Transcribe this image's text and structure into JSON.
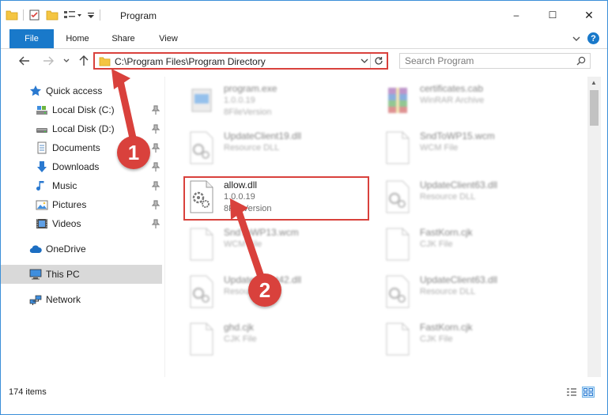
{
  "window": {
    "title": "Program",
    "controls": {
      "minimize": "–",
      "maximize": "☐",
      "close": "✕"
    }
  },
  "ribbon": {
    "tabs": [
      {
        "label": "File"
      },
      {
        "label": "Home"
      },
      {
        "label": "Share"
      },
      {
        "label": "View"
      }
    ],
    "help": "?"
  },
  "address_bar": {
    "path": "C:\\Program Files\\Program Directory",
    "search_placeholder": "Search Program"
  },
  "sidebar": {
    "items": [
      {
        "label": "Quick access",
        "icon": "star-icon"
      },
      {
        "label": "Local Disk (C:)",
        "icon": "drive-icon",
        "pinned": true
      },
      {
        "label": "Local Disk (D:)",
        "icon": "drive-icon",
        "pinned": true
      },
      {
        "label": "Documents",
        "icon": "documents-icon",
        "pinned": true
      },
      {
        "label": "Downloads",
        "icon": "downloads-icon",
        "pinned": true
      },
      {
        "label": "Music",
        "icon": "music-icon",
        "pinned": true
      },
      {
        "label": "Pictures",
        "icon": "pictures-icon",
        "pinned": true
      },
      {
        "label": "Videos",
        "icon": "videos-icon",
        "pinned": true
      },
      {
        "label": "OneDrive",
        "icon": "cloud-icon"
      },
      {
        "label": "This PC",
        "icon": "computer-icon",
        "selected": true
      },
      {
        "label": "Network",
        "icon": "network-icon"
      }
    ]
  },
  "files": [
    {
      "name": "program.exe",
      "line1": "1.0.0.19",
      "line2": "8FileVersion",
      "icon": "exe-icon"
    },
    {
      "name": "certificates.cab",
      "line1": "WinRAR Archive",
      "line2": "",
      "icon": "archive-icon"
    },
    {
      "name": "UpdateClient19.dll",
      "line1": "Resource DLL",
      "line2": "",
      "icon": "dll-icon"
    },
    {
      "name": "SndToWP15.wcm",
      "line1": "WCM File",
      "line2": "",
      "icon": "blank-file-icon"
    },
    {
      "name": "allow.dll",
      "line1": "1.0.0.19",
      "line2": "8FileVersion",
      "icon": "dll-icon",
      "highlighted": true
    },
    {
      "name": "UpdateClient63.dll",
      "line1": "Resource DLL",
      "line2": "",
      "icon": "dll-icon"
    },
    {
      "name": "SndToWP13.wcm",
      "line1": "WCM File",
      "line2": "",
      "icon": "blank-file-icon"
    },
    {
      "name": "FastKorn.cjk",
      "line1": "CJK File",
      "line2": "",
      "icon": "blank-file-icon"
    },
    {
      "name": "UpdateClient42.dll",
      "line1": "Resource DLL",
      "line2": "",
      "icon": "dll-icon"
    },
    {
      "name": "UpdateClient63.dll",
      "line1": "Resource DLL",
      "line2": "",
      "icon": "dll-icon"
    },
    {
      "name": "ghd.cjk",
      "line1": "CJK File",
      "line2": "",
      "icon": "blank-file-icon"
    },
    {
      "name": "FastKorn.cjk",
      "line1": "CJK File",
      "line2": "",
      "icon": "blank-file-icon"
    }
  ],
  "status": {
    "item_count": "174 items"
  },
  "annotations": {
    "step1": "1",
    "step2": "2"
  },
  "colors": {
    "accent": "#1979ca",
    "annotation_red": "#d9413c",
    "selection": "#d9d9d9"
  }
}
